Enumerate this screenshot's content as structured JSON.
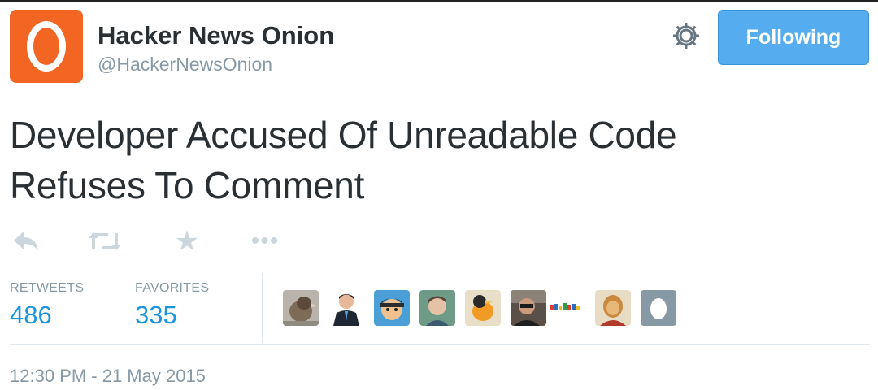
{
  "account": {
    "name": "Hacker News Onion",
    "handle": "@HackerNewsOnion",
    "avatar_color": "#f26522",
    "avatar_letter": "O"
  },
  "header": {
    "settings_icon": "gear-icon",
    "follow_button_label": "Following",
    "follow_button_color": "#55acee"
  },
  "tweet": {
    "text_line_1": "Developer Accused Of Unreadable Code",
    "text_line_2": "Refuses To Comment"
  },
  "actions": [
    {
      "name": "reply",
      "icon": "reply-icon"
    },
    {
      "name": "retweet",
      "icon": "retweet-icon"
    },
    {
      "name": "favorite",
      "icon": "star-icon"
    },
    {
      "name": "more",
      "icon": "more-icon"
    }
  ],
  "stats": {
    "retweets_label": "RETWEETS",
    "retweets_count": "486",
    "favorites_label": "FAVORITES",
    "favorites_count": "335",
    "count_color": "#1b95e0"
  },
  "favoriters": [
    {
      "label": "user-avatar-1",
      "style": "bird"
    },
    {
      "label": "user-avatar-2",
      "style": "suit"
    },
    {
      "label": "user-avatar-3",
      "style": "cartoon"
    },
    {
      "label": "user-avatar-4",
      "style": "face"
    },
    {
      "label": "user-avatar-5",
      "style": "bird"
    },
    {
      "label": "user-avatar-6",
      "style": "face"
    },
    {
      "label": "user-avatar-7",
      "style": "toysrus"
    },
    {
      "label": "user-avatar-8",
      "style": "face"
    },
    {
      "label": "user-avatar-9",
      "style": "egg"
    }
  ],
  "meta": {
    "timestamp": "12:30 PM - 21 May 2015"
  }
}
